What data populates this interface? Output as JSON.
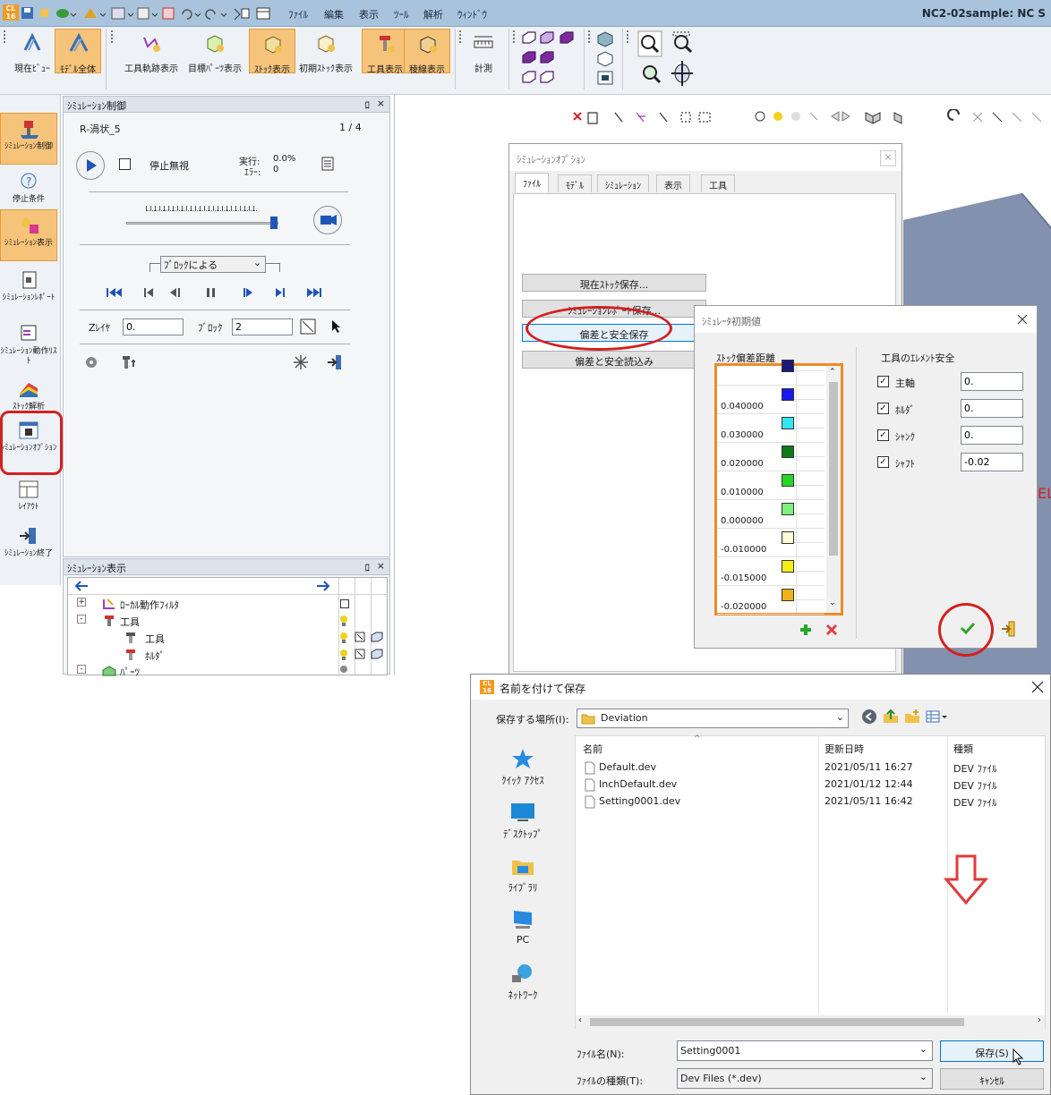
{
  "titlebar": {
    "title": "NC2-02sample: NC S",
    "menus": [
      "ﾌｧｲﾙ",
      "編集",
      "表示",
      "ﾂｰﾙ",
      "解析",
      "ｳｨﾝﾄﾞｳ"
    ]
  },
  "ribbon": {
    "buttons": [
      {
        "label": "現在ﾋﾞｭｰ",
        "selected": false
      },
      {
        "label": "ﾓﾃﾞﾙ全体",
        "selected": true
      },
      {
        "label": "工具軌跡表示",
        "selected": false
      },
      {
        "label": "目標ﾊﾟｰﾂ表示",
        "selected": false
      },
      {
        "label": "ｽﾄｯｸ表示",
        "selected": true
      },
      {
        "label": "初期ｽﾄｯｸ表示",
        "selected": false
      },
      {
        "label": "工具表示",
        "selected": true
      },
      {
        "label": "稜線表示",
        "selected": true
      },
      {
        "label": "計測",
        "selected": false
      }
    ]
  },
  "vtool": {
    "items": [
      {
        "label": "ｼﾐｭﾚｰｼｮﾝ制御",
        "selected": true
      },
      {
        "label": "停止条件",
        "selected": false
      },
      {
        "label": "ｼﾐｭﾚｰｼｮﾝ表示",
        "selected": true
      },
      {
        "label": "ｼﾐｭﾚｰｼｮﾝﾚﾎﾟｰﾄ",
        "selected": false
      },
      {
        "label": "ｼﾐｭﾚｰｼｮﾝ動作ﾘｽﾄ",
        "selected": false
      },
      {
        "label": "ｽﾄｯｸ解析",
        "selected": false
      },
      {
        "label": "ｼﾐｭﾚｰｼｮﾝｵﾌﾟｼｮﾝ",
        "selected": false
      },
      {
        "label": "ﾚｲｱｳﾄ",
        "selected": false
      },
      {
        "label": "ｼﾐｭﾚｰｼｮﾝ終了",
        "selected": false
      }
    ]
  },
  "sim_control": {
    "title": "ｼﾐｭﾚｰｼｮﾝ制御",
    "pin": "ﾛ",
    "close": "×",
    "program": "R-渦状_5",
    "page": "1 / 4",
    "ignore_stop": "停止無視",
    "exec_label": "実行:",
    "exec_value": "0.0%",
    "error_label": "ｴﾗｰ:",
    "error_value": "0",
    "mode": "ﾌﾞﾛｯｸによる",
    "z_layer_label": "Zﾚｲﾔ",
    "z_layer_value": "0.",
    "block_label": "ﾌﾞﾛｯｸ",
    "block_value": "2"
  },
  "sim_display": {
    "title": "ｼﾐｭﾚｰｼｮﾝ表示",
    "tree": [
      {
        "label": "ﾛｰｶﾙ動作ﾌｨﾙﾀ",
        "expander": "+"
      },
      {
        "label": "工具",
        "expander": "-"
      },
      {
        "label": "工具",
        "expander": ""
      },
      {
        "label": "ﾎﾙﾀﾞ",
        "expander": ""
      },
      {
        "label": "ﾊﾟｰﾂ",
        "expander": "-"
      }
    ]
  },
  "options_dialog": {
    "title": "ｼﾐｭﾚｰｼｮﾝｵﾌﾟｼｮﾝ",
    "tabs": [
      "ﾌｧｲﾙ",
      "ﾓﾃﾞﾙ",
      "ｼﾐｭﾚｰｼｮﾝ",
      "表示",
      "工具"
    ],
    "buttons": [
      "現在ｽﾄｯｸ保存...",
      "ｼﾐｭﾚｰｼｮﾝﾚﾎﾟｰﾄ保存...",
      "偏差と安全保存",
      "偏差と安全読込み"
    ]
  },
  "init_dialog": {
    "title": "ｼﾐｭﾚｰﾀ初期値",
    "deviation_header": "ｽﾄｯｸ偏差距離",
    "rows": [
      {
        "value": "",
        "color": "#1a1a7a"
      },
      {
        "value": "0.040000",
        "color": "#1a1aee"
      },
      {
        "value": "0.030000",
        "color": "#33e6f0"
      },
      {
        "value": "0.020000",
        "color": "#0f7a1a"
      },
      {
        "value": "0.010000",
        "color": "#26d626"
      },
      {
        "value": "0.000000",
        "color": "#7df07d"
      },
      {
        "value": "-0.010000",
        "color": "#fdfbd8"
      },
      {
        "value": "-0.015000",
        "color": "#f5ee1a"
      },
      {
        "value": "-0.020000",
        "color": "#f0b21a"
      }
    ],
    "safety_header": "工具のｴﾚﾒﾝﾄ安全",
    "safety": [
      {
        "label": "主軸",
        "value": "0.",
        "checked": true
      },
      {
        "label": "ﾎﾙﾀﾞ",
        "value": "0.",
        "checked": true
      },
      {
        "label": "ｼｬﾝｸ",
        "value": "0.",
        "checked": true
      },
      {
        "label": "ｼｬﾌﾄ",
        "value": "-0.02",
        "checked": true
      }
    ]
  },
  "save_dialog": {
    "title": "名前を付けて保存",
    "location_label": "保存する場所(I):",
    "location": "Deviation",
    "nav": [
      "ｸｲｯｸ ｱｸｾｽ",
      "ﾃﾞｽｸﾄｯﾌﾟ",
      "ﾗｲﾌﾞﾗﾘ",
      "PC",
      "ﾈｯﾄﾜｰｸ"
    ],
    "columns": [
      "名前",
      "更新日時",
      "種類"
    ],
    "files": [
      {
        "name": "Default.dev",
        "date": "2021/05/11 16:27",
        "type": "DEV ﾌｧｲﾙ"
      },
      {
        "name": "InchDefault.dev",
        "date": "2021/01/12 12:44",
        "type": "DEV ﾌｧｲﾙ"
      },
      {
        "name": "Setting0001.dev",
        "date": "2021/05/11 16:42",
        "type": "DEV ﾌｧｲﾙ"
      }
    ],
    "filename_label": "ﾌｧｲﾙ名(N):",
    "filename": "Setting0001",
    "filetype_label": "ﾌｧｲﾙの種類(T):",
    "filetype": "Dev Files (*.dev)",
    "save": "保存(S)",
    "cancel": "ｷｬﾝｾﾙ"
  },
  "colors": {
    "accent_selected": "#f6c37a",
    "annotation_red": "#d42020"
  }
}
